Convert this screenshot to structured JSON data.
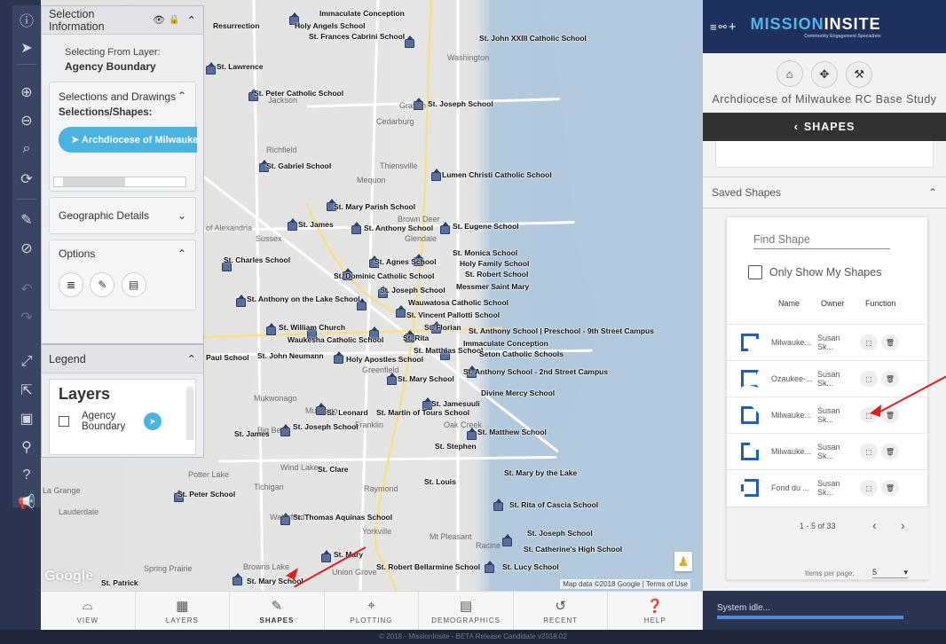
{
  "map": {
    "places": [
      {
        "t": "Resurrection"
      },
      {
        "t": "Holy Angels School"
      },
      {
        "t": "Immaculate Conception"
      },
      {
        "t": "St. Frances Cabrini School"
      },
      {
        "t": "St. John XXIII Catholic School"
      },
      {
        "t": "St. Lawrence"
      },
      {
        "t": "St. Peter Catholic School"
      },
      {
        "t": "St. Joseph School"
      },
      {
        "t": "St. Gabriel School"
      },
      {
        "t": "Lumen Christi Catholic School"
      },
      {
        "t": "St. Mary Parish School"
      },
      {
        "t": "St. James"
      },
      {
        "t": "St. Anthony School"
      },
      {
        "t": "St. Eugene School"
      },
      {
        "t": "St. Charles School"
      },
      {
        "t": "St. Agnes School"
      },
      {
        "t": "St. Monica School"
      },
      {
        "t": "Holy Family School"
      },
      {
        "t": "St. Dominic Catholic School"
      },
      {
        "t": "St. Robert School"
      },
      {
        "t": "Messmer Saint Mary"
      },
      {
        "t": "St. Joseph School"
      },
      {
        "t": "St. Anthony on the Lake School"
      },
      {
        "t": "Wauwatosa Catholic School"
      },
      {
        "t": "St. Vincent Pallotti School"
      },
      {
        "t": "St. William Church"
      },
      {
        "t": "Waukesha Catholic School"
      },
      {
        "t": "St. Florian"
      },
      {
        "t": "St. Rita"
      },
      {
        "t": "St. Anthony School | Preschool - 9th Street Campus"
      },
      {
        "t": "Immaculate Conception"
      },
      {
        "t": "St. John Neumann"
      },
      {
        "t": "Holy Apostles School"
      },
      {
        "t": "St. Matthias School"
      },
      {
        "t": "Seton Catholic Schools"
      },
      {
        "t": "St. Anthony School - 2nd Street Campus"
      },
      {
        "t": "St. Mary School"
      },
      {
        "t": "Divine Mercy School"
      },
      {
        "t": "St. Leonard"
      },
      {
        "t": "St. Martin of Tours School"
      },
      {
        "t": "St. Jamesuuli"
      },
      {
        "t": "St. Joseph School"
      },
      {
        "t": "St. James"
      },
      {
        "t": "St. Matthew School"
      },
      {
        "t": "St. Stephen"
      },
      {
        "t": "St. Clare"
      },
      {
        "t": "St. Louis"
      },
      {
        "t": "St. Mary by the Lake"
      },
      {
        "t": "St. Peter School"
      },
      {
        "t": "St. Rita of Cascia School"
      },
      {
        "t": "St. Thomas Aquinas School"
      },
      {
        "t": "St. Joseph School"
      },
      {
        "t": "St. Mary"
      },
      {
        "t": "St. Catherine's High School"
      },
      {
        "t": "St. Robert Bellarmine School"
      },
      {
        "t": "St. Lucy School"
      },
      {
        "t": "St. Patrick"
      },
      {
        "t": "St. Mary School"
      },
      {
        "t": "Paul School"
      }
    ],
    "towns": [
      {
        "t": "Washington"
      },
      {
        "t": "Jackson"
      },
      {
        "t": "Grafton"
      },
      {
        "t": "Cedarburg"
      },
      {
        "t": "Richfield"
      },
      {
        "t": "Thiensville"
      },
      {
        "t": "Mequon"
      },
      {
        "t": "Brown Deer"
      },
      {
        "t": "Glendale"
      },
      {
        "t": "Sussex"
      },
      {
        "t": "of Alexandria"
      },
      {
        "t": "Greenfield"
      },
      {
        "t": "Franklin"
      },
      {
        "t": "Oak Creek"
      },
      {
        "t": "Raymond"
      },
      {
        "t": "Potter Lake"
      },
      {
        "t": "La Grange"
      },
      {
        "t": "Lauderdale"
      },
      {
        "t": "Tichigan"
      },
      {
        "t": "Waterford"
      },
      {
        "t": "Yorkville"
      },
      {
        "t": "Mt Pleasant"
      },
      {
        "t": "Racine"
      },
      {
        "t": "Spring Prairie"
      },
      {
        "t": "Browns Lake"
      },
      {
        "t": "Union Grove"
      },
      {
        "t": "Wind Lake"
      },
      {
        "t": "Mukwonago"
      },
      {
        "t": "Big Bend"
      },
      {
        "t": "Muskego"
      }
    ],
    "google_logo": "Google",
    "attribution": "Map data ©2018 Google | Terms of Use"
  },
  "selection_panel": {
    "title": "Selection Information",
    "selecting_from_label": "Selecting From Layer:",
    "layer_name": "Agency Boundary",
    "selections_title": "Selections and Drawings",
    "shapes_label": "Selections/Shapes:",
    "shape_pill": "Archdiocese of Milwaukee",
    "geo_title": "Geographic Details",
    "options_title": "Options"
  },
  "legend": {
    "title": "Legend",
    "layers_title": "Layers",
    "layer_item": "Agency Boundary"
  },
  "bottom_bar": [
    {
      "label": "VIEW",
      "icon": "binoculars-icon"
    },
    {
      "label": "LAYERS",
      "icon": "map-icon"
    },
    {
      "label": "SHAPES",
      "icon": "pencil-icon"
    },
    {
      "label": "PLOTTING",
      "icon": "pin-icon"
    },
    {
      "label": "DEMOGRAPHICS",
      "icon": "stats-icon"
    },
    {
      "label": "RECENT",
      "icon": "history-icon"
    },
    {
      "label": "HELP",
      "icon": "help-icon"
    }
  ],
  "footer": "© 2018 - MissionInsite - BETA Release Candidate v2018.02",
  "right_panel": {
    "brand_prefix": "MISSION",
    "brand_suffix": "INSITE",
    "brand_sub": "Community Engagement Specialists",
    "study_title": "Archdiocese of Milwaukee RC Base Study",
    "shapes_header": "SHAPES",
    "saved_shapes": "Saved Shapes",
    "find_placeholder": "Find Shape",
    "only_mine": "Only Show My Shapes",
    "col_name": "Name",
    "col_owner": "Owner",
    "col_function": "Function",
    "rows": [
      {
        "name": "Milwauke...",
        "owner": "Susan Sk..."
      },
      {
        "name": "Ozaukee-...",
        "owner": "Susan Sk..."
      },
      {
        "name": "Milwauke...",
        "owner": "Susan Sk..."
      },
      {
        "name": "Milwauke...",
        "owner": "Susan Sk..."
      },
      {
        "name": "Fond du ...",
        "owner": "Susan Sk..."
      }
    ],
    "pagination": "1 - 5 of 33",
    "items_per_page_label": "Items per page:",
    "items_per_page": "5",
    "status": "System idle..."
  },
  "colors": {
    "accent": "#4bb3e0",
    "brand_bar": "#20305c",
    "shape_icon": "#1f5fb5",
    "annotation_arrow": "#e02020"
  }
}
